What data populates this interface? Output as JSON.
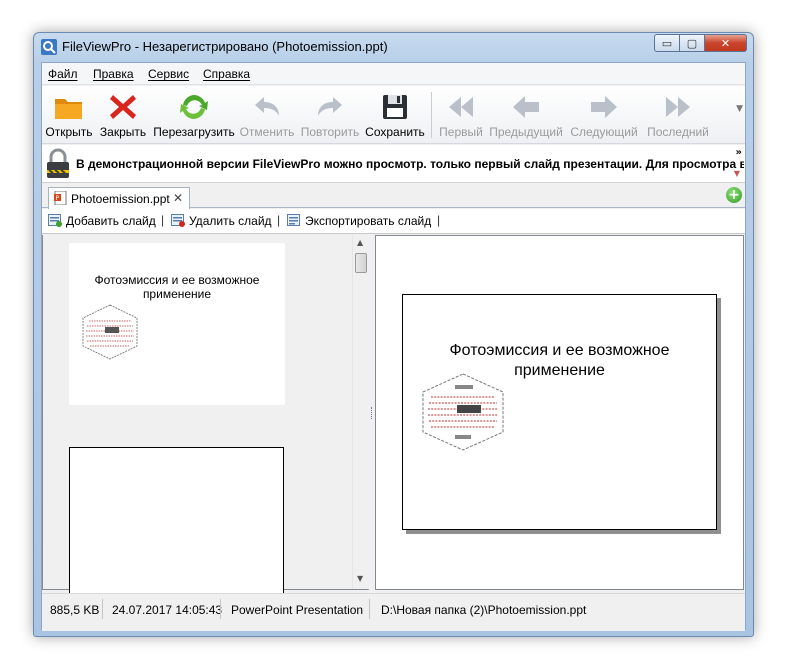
{
  "window": {
    "title": "FileViewPro - Незарегистрировано (Photoemission.ppt)",
    "controls": {
      "minimize": "▭",
      "maximize": "▢",
      "close": "✕"
    }
  },
  "menu": [
    "Файл",
    "Правка",
    "Сервис",
    "Справка"
  ],
  "toolbar": {
    "open": "Открыть",
    "close": "Закрыть",
    "reload": "Перезагрузить",
    "undo": "Отменить",
    "redo": "Повторить",
    "save": "Сохранить",
    "first": "Первый",
    "previous": "Предыдущий",
    "next": "Следующий",
    "last": "Последний"
  },
  "infobar": {
    "text": "В демонстрационной версии FileViewPro можно просмотр. только первый слайд презентации. Для просмотра всех",
    "more": "»"
  },
  "tabs": [
    {
      "label": "Photoemission.ppt",
      "close": "✕"
    }
  ],
  "slide_toolbar": {
    "add": "Добавить слайд",
    "delete": "Удалить слайд",
    "export": "Экспортировать слайд",
    "separator": "|"
  },
  "slide": {
    "title_line1": "Фотоэмиссия и ее возможное",
    "title_line2": "применение"
  },
  "status": {
    "size": "885,5 KB",
    "date": "24.07.2017 14:05:43",
    "type": "PowerPoint Presentation",
    "path": "D:\\Новая папка (2)\\Photoemission.ppt"
  }
}
